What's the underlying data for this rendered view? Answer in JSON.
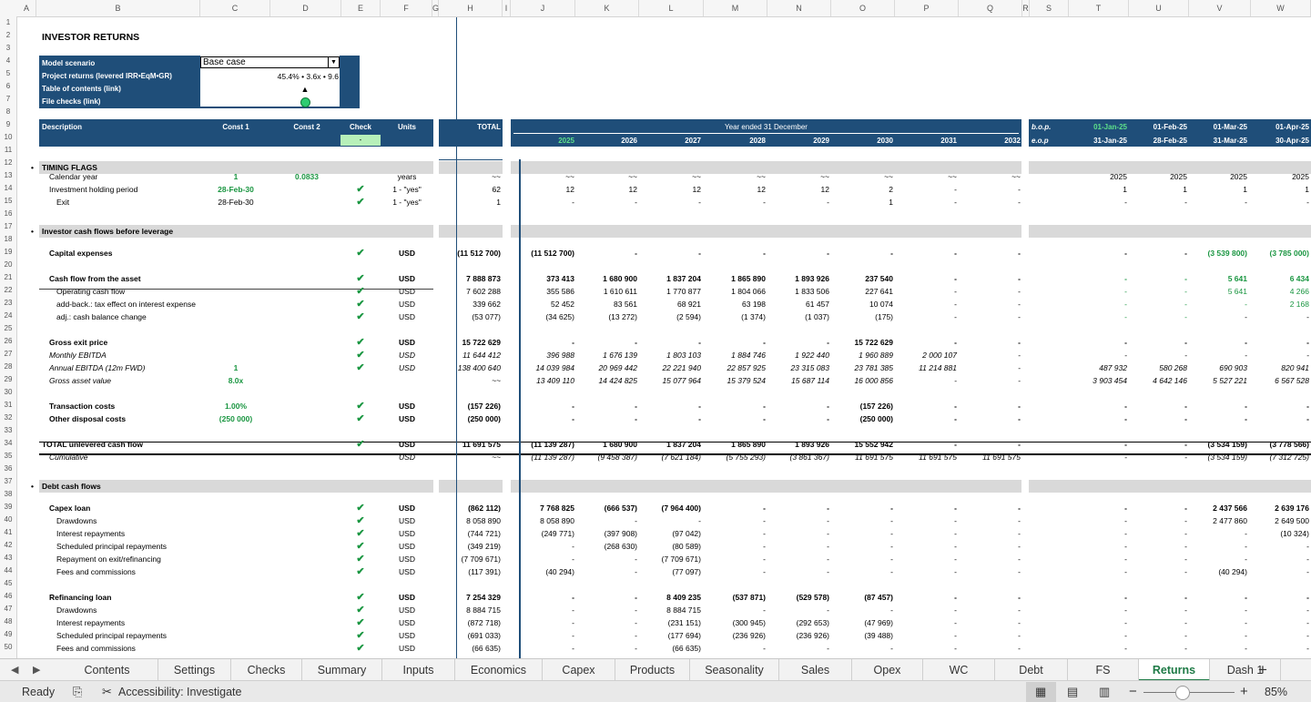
{
  "columns": [
    "A",
    "B",
    "C",
    "D",
    "E",
    "F",
    "G",
    "H",
    "I",
    "J",
    "K",
    "L",
    "M",
    "N",
    "O",
    "P",
    "Q",
    "R",
    "S",
    "T",
    "U",
    "V",
    "W"
  ],
  "rows": [
    "1",
    "2",
    "3",
    "4",
    "5",
    "6",
    "7",
    "8",
    "9",
    "10",
    "11",
    "12",
    "13",
    "14",
    "15",
    "16",
    "17",
    "18",
    "19",
    "20",
    "21",
    "22",
    "23",
    "24",
    "25",
    "26",
    "27",
    "28",
    "29",
    "30",
    "31",
    "32",
    "33",
    "34",
    "35",
    "36",
    "37",
    "38",
    "39",
    "40",
    "41",
    "42",
    "43",
    "44",
    "45",
    "46",
    "47",
    "48",
    "49",
    "50"
  ],
  "title": "INVESTOR RETURNS",
  "info_box": {
    "model_scenario_label": "Model scenario",
    "model_scenario_value": "Base case",
    "project_returns_label": "Project returns (levered IRR•EqM•GR)",
    "project_returns_value": "45.4% • 3.6x • 9.6",
    "toc_label": "Table of contents (link)",
    "toc_value": "▲",
    "file_checks_label": "File checks (link)"
  },
  "header": {
    "description": "Description",
    "const1": "Const 1",
    "const2": "Const 2",
    "check": "Check",
    "check_value": "-",
    "units": "Units",
    "total": "TOTAL",
    "year_ended": "Year ended 31 December",
    "years": [
      "2025",
      "2026",
      "2027",
      "2028",
      "2029",
      "2030",
      "2031",
      "2032"
    ],
    "bop": "b.o.p.",
    "eop": "e.o.p",
    "month_starts": [
      "01-Jan-25",
      "01-Feb-25",
      "01-Mar-25",
      "01-Apr-25"
    ],
    "month_ends": [
      "31-Jan-25",
      "28-Feb-25",
      "31-Mar-25",
      "30-Apr-25"
    ]
  },
  "sections": {
    "timing": "TIMING FLAGS",
    "cf_before": "Investor cash flows before leverage",
    "debt": "Debt cash flows"
  },
  "lines": [
    {
      "row": 13,
      "label": "Calendar year",
      "indent": 1,
      "c1": "1",
      "c2": "0.0833",
      "check": false,
      "units": "years",
      "total": "~~",
      "years": [
        "~~",
        "~~",
        "~~",
        "~~",
        "~~",
        "~~",
        "~~",
        "~~"
      ],
      "months": [
        "2025",
        "2025",
        "2025",
        "2025"
      ]
    },
    {
      "row": 14,
      "label": "Investment holding period",
      "indent": 1,
      "c1": "28-Feb-30",
      "c1green": true,
      "check": true,
      "units": "1 - \"yes\"",
      "total": "62",
      "years": [
        "12",
        "12",
        "12",
        "12",
        "12",
        "2",
        "-",
        "-"
      ],
      "months": [
        "1",
        "1",
        "1",
        "1"
      ]
    },
    {
      "row": 15,
      "label": "Exit",
      "indent": 2,
      "c1": "28-Feb-30",
      "check": true,
      "units": "1 - \"yes\"",
      "total": "1",
      "years": [
        "-",
        "-",
        "-",
        "-",
        "-",
        "1",
        "-",
        "-"
      ],
      "months": [
        "-",
        "-",
        "-",
        "-"
      ]
    },
    {
      "row": 19,
      "label": "Capital expenses",
      "bold": true,
      "indent": 1,
      "check": true,
      "units": "USD",
      "total": "(11 512 700)",
      "years": [
        "(11 512 700)",
        "-",
        "-",
        "-",
        "-",
        "-",
        "-",
        "-"
      ],
      "months": [
        "-",
        "-",
        "(3 539 800)",
        "(3 785 000)"
      ],
      "mgreen": [
        2,
        3
      ]
    },
    {
      "row": 21,
      "label": "Cash flow from the asset",
      "bold": true,
      "indent": 1,
      "check": true,
      "units": "USD",
      "total": "7 888 873",
      "years": [
        "373 413",
        "1 680 900",
        "1 837 204",
        "1 865 890",
        "1 893 926",
        "237 540",
        "-",
        "-"
      ],
      "months": [
        "-",
        "-",
        "5 641",
        "6 434"
      ],
      "mgreen": [
        0,
        1,
        2,
        3
      ]
    },
    {
      "row": 22,
      "label": "Operating cash flow",
      "indent": 2,
      "check": true,
      "units": "USD",
      "total": "7 602 288",
      "years": [
        "355 586",
        "1 610 611",
        "1 770 877",
        "1 804 066",
        "1 833 506",
        "227 641",
        "-",
        "-"
      ],
      "months": [
        "-",
        "-",
        "5 641",
        "4 266"
      ],
      "mgreen": [
        0,
        1,
        2,
        3
      ]
    },
    {
      "row": 23,
      "label": "add-back.: tax effect on interest expense",
      "indent": 2,
      "check": true,
      "units": "USD",
      "total": "339 662",
      "years": [
        "52 452",
        "83 561",
        "68 921",
        "63 198",
        "61 457",
        "10 074",
        "-",
        "-"
      ],
      "months": [
        "-",
        "-",
        "-",
        "2 168"
      ],
      "mgreen": [
        0,
        1,
        2,
        3
      ]
    },
    {
      "row": 24,
      "label": "adj.: cash balance change",
      "indent": 2,
      "check": true,
      "units": "USD",
      "total": "(53 077)",
      "years": [
        "(34 625)",
        "(13 272)",
        "(2 594)",
        "(1 374)",
        "(1 037)",
        "(175)",
        "-",
        "-"
      ],
      "months": [
        "-",
        "-",
        "-",
        "-"
      ],
      "mgreen": [
        0,
        1
      ]
    },
    {
      "row": 26,
      "label": "Gross exit price",
      "bold": true,
      "indent": 1,
      "check": true,
      "units": "USD",
      "total": "15 722 629",
      "years": [
        "-",
        "-",
        "-",
        "-",
        "-",
        "15 722 629",
        "-",
        "-"
      ],
      "months": [
        "-",
        "-",
        "-",
        "-"
      ]
    },
    {
      "row": 27,
      "label": "Monthly EBITDA",
      "italic": true,
      "indent": 1,
      "check": true,
      "units": "USD",
      "total": "11 644 412",
      "years": [
        "396 988",
        "1 676 139",
        "1 803 103",
        "1 884 746",
        "1 922 440",
        "1 960 889",
        "2 000 107",
        "-"
      ],
      "months": [
        "-",
        "-",
        "-",
        "-"
      ]
    },
    {
      "row": 28,
      "label": "Annual EBITDA (12m FWD)",
      "italic": true,
      "indent": 1,
      "c1": "1",
      "c1green": true,
      "check": true,
      "units": "USD",
      "total": "138 400 640",
      "years": [
        "14 039 984",
        "20 969 442",
        "22 221 940",
        "22 857 925",
        "23 315 083",
        "23 781 385",
        "11 214 881",
        "-"
      ],
      "months": [
        "487 932",
        "580 268",
        "690 903",
        "820 941"
      ]
    },
    {
      "row": 29,
      "label": "Gross asset value",
      "italic": true,
      "indent": 1,
      "c1": "8.0x",
      "c1green": true,
      "c1bold": true,
      "check": false,
      "units": "",
      "total": "~~",
      "years": [
        "13 409 110",
        "14 424 825",
        "15 077 964",
        "15 379 524",
        "15 687 114",
        "16 000 856",
        "-",
        "-"
      ],
      "months": [
        "3 903 454",
        "4 642 146",
        "5 527 221",
        "6 567 528"
      ]
    },
    {
      "row": 31,
      "label": "Transaction costs",
      "bold": true,
      "indent": 1,
      "c1": "1.00%",
      "c1green": true,
      "c1bold": true,
      "check": true,
      "units": "USD",
      "total": "(157 226)",
      "years": [
        "-",
        "-",
        "-",
        "-",
        "-",
        "(157 226)",
        "-",
        "-"
      ],
      "months": [
        "-",
        "-",
        "-",
        "-"
      ]
    },
    {
      "row": 32,
      "label": "Other disposal costs",
      "bold": true,
      "indent": 1,
      "c1": "(250 000)",
      "c1green": true,
      "c1bold": true,
      "check": true,
      "units": "USD",
      "total": "(250 000)",
      "years": [
        "-",
        "-",
        "-",
        "-",
        "-",
        "(250 000)",
        "-",
        "-"
      ],
      "months": [
        "-",
        "-",
        "-",
        "-"
      ]
    },
    {
      "row": 34,
      "label": "TOTAL unlevered cash flow",
      "bold": true,
      "indent": 0,
      "check": true,
      "units": "USD",
      "total": "11 691 575",
      "years": [
        "(11 139 287)",
        "1 680 900",
        "1 837 204",
        "1 865 890",
        "1 893 926",
        "15 552 942",
        "-",
        "-"
      ],
      "months": [
        "-",
        "-",
        "(3 534 159)",
        "(3 778 566)"
      ]
    },
    {
      "row": 35,
      "label": "Cumulative",
      "italic": true,
      "indent": 1,
      "check": false,
      "units": "USD",
      "total": "~~",
      "years": [
        "(11 139 287)",
        "(9 458 387)",
        "(7 621 184)",
        "(5 755 293)",
        "(3 861 367)",
        "11 691 575",
        "11 691 575",
        "11 691 575"
      ],
      "months": [
        "-",
        "-",
        "(3 534 159)",
        "(7 312 725)"
      ]
    },
    {
      "row": 39,
      "label": "Capex loan",
      "bold": true,
      "indent": 1,
      "check": true,
      "units": "USD",
      "total": "(862 112)",
      "years": [
        "7 768 825",
        "(666 537)",
        "(7 964 400)",
        "-",
        "-",
        "-",
        "-",
        "-"
      ],
      "months": [
        "-",
        "-",
        "2 437 566",
        "2 639 176"
      ]
    },
    {
      "row": 40,
      "label": "Drawdowns",
      "indent": 2,
      "check": true,
      "units": "USD",
      "total": "8 058 890",
      "years": [
        "8 058 890",
        "-",
        "-",
        "-",
        "-",
        "-",
        "-",
        "-"
      ],
      "months": [
        "-",
        "-",
        "2 477 860",
        "2 649 500"
      ]
    },
    {
      "row": 41,
      "label": "Interest repayments",
      "indent": 2,
      "check": true,
      "units": "USD",
      "total": "(744 721)",
      "years": [
        "(249 771)",
        "(397 908)",
        "(97 042)",
        "-",
        "-",
        "-",
        "-",
        "-"
      ],
      "months": [
        "-",
        "-",
        "-",
        "(10 324)"
      ]
    },
    {
      "row": 42,
      "label": "Scheduled principal repayments",
      "indent": 2,
      "check": true,
      "units": "USD",
      "total": "(349 219)",
      "years": [
        "-",
        "(268 630)",
        "(80 589)",
        "-",
        "-",
        "-",
        "-",
        "-"
      ],
      "months": [
        "-",
        "-",
        "-",
        "-"
      ]
    },
    {
      "row": 43,
      "label": "Repayment on exit/refinancing",
      "indent": 2,
      "check": true,
      "units": "USD",
      "total": "(7 709 671)",
      "years": [
        "-",
        "-",
        "(7 709 671)",
        "-",
        "-",
        "-",
        "-",
        "-"
      ],
      "months": [
        "-",
        "-",
        "-",
        "-"
      ]
    },
    {
      "row": 44,
      "label": "Fees and commissions",
      "indent": 2,
      "check": true,
      "units": "USD",
      "total": "(117 391)",
      "years": [
        "(40 294)",
        "-",
        "(77 097)",
        "-",
        "-",
        "-",
        "-",
        "-"
      ],
      "months": [
        "-",
        "-",
        "(40 294)",
        "-"
      ]
    },
    {
      "row": 46,
      "label": "Refinancing loan",
      "bold": true,
      "indent": 1,
      "check": true,
      "units": "USD",
      "total": "7 254 329",
      "years": [
        "-",
        "-",
        "8 409 235",
        "(537 871)",
        "(529 578)",
        "(87 457)",
        "-",
        "-"
      ],
      "months": [
        "-",
        "-",
        "-",
        "-"
      ]
    },
    {
      "row": 47,
      "label": "Drawdowns",
      "indent": 2,
      "check": true,
      "units": "USD",
      "total": "8 884 715",
      "years": [
        "-",
        "-",
        "8 884 715",
        "-",
        "-",
        "-",
        "-",
        "-"
      ],
      "months": [
        "-",
        "-",
        "-",
        "-"
      ]
    },
    {
      "row": 48,
      "label": "Interest repayments",
      "indent": 2,
      "check": true,
      "units": "USD",
      "total": "(872 718)",
      "years": [
        "-",
        "-",
        "(231 151)",
        "(300 945)",
        "(292 653)",
        "(47 969)",
        "-",
        "-"
      ],
      "months": [
        "-",
        "-",
        "-",
        "-"
      ]
    },
    {
      "row": 49,
      "label": "Scheduled principal repayments",
      "indent": 2,
      "check": true,
      "units": "USD",
      "total": "(691 033)",
      "years": [
        "-",
        "-",
        "(177 694)",
        "(236 926)",
        "(236 926)",
        "(39 488)",
        "-",
        "-"
      ],
      "months": [
        "-",
        "-",
        "-",
        "-"
      ]
    },
    {
      "row": 50,
      "label": "Fees and commissions",
      "indent": 2,
      "check": true,
      "units": "USD",
      "total": "(66 635)",
      "years": [
        "-",
        "-",
        "(66 635)",
        "-",
        "-",
        "-",
        "-",
        "-"
      ],
      "months": [
        "-",
        "-",
        "-",
        "-"
      ]
    }
  ],
  "tabs": [
    "Contents",
    "Settings",
    "Checks",
    "Summary",
    "Inputs",
    "Economics",
    "Capex",
    "Products",
    "Seasonality",
    "Sales",
    "Opex",
    "WC",
    "Debt",
    "FS",
    "Returns",
    "Dash 1"
  ],
  "active_tab": "Returns",
  "add_sheet": "+",
  "status": {
    "ready": "Ready",
    "accessibility": "Accessibility: Investigate",
    "zoom": "85%"
  },
  "colors": {
    "navy": "#1f4e79",
    "green": "#1a9641",
    "band": "#d9d9d9",
    "active_tab": "#1e7a46"
  }
}
